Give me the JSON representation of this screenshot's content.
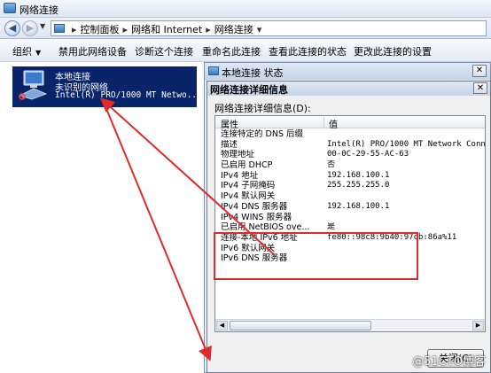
{
  "window": {
    "title": "网络连接"
  },
  "address": {
    "breadcrumbs": [
      "控制面板",
      "网络和 Internet",
      "网络连接"
    ]
  },
  "toolbar": {
    "organize": "组织",
    "disable": "禁用此网络设备",
    "diagnose": "诊断这个连接",
    "rename": "重命名此连接",
    "status": "查看此连接的状态",
    "settings": "更改此连接的设置"
  },
  "connection": {
    "name": "本地连接",
    "status": "未识别的网络",
    "device": "Intel(R) PRO/1000 MT Netwo..."
  },
  "status_window": {
    "title": "本地连接 状态"
  },
  "details": {
    "title": "网络连接详细信息",
    "label": "网络连接详细信息(D):",
    "columns": {
      "property": "属性",
      "value": "值"
    },
    "rows": [
      {
        "property": "连接特定的 DNS 后缀",
        "value": ""
      },
      {
        "property": "描述",
        "value": "Intel(R) PRO/1000 MT Network Conn"
      },
      {
        "property": "物理地址",
        "value": "00-0C-29-55-AC-63"
      },
      {
        "property": "已启用 DHCP",
        "value": "否"
      },
      {
        "property": "IPv4 地址",
        "value": "192.168.100.1"
      },
      {
        "property": "IPv4 子网掩码",
        "value": "255.255.255.0"
      },
      {
        "property": "IPv4 默认网关",
        "value": ""
      },
      {
        "property": "IPv4 DNS 服务器",
        "value": "192.168.100.1"
      },
      {
        "property": "IPv4 WINS 服务器",
        "value": ""
      },
      {
        "property": "已启用 NetBIOS ove...",
        "value": "是"
      },
      {
        "property": "连接-本地 IPv6 地址",
        "value": "fe80::98c8:9b40:97cb:86a%11"
      },
      {
        "property": "IPv6 默认网关",
        "value": ""
      },
      {
        "property": "IPv6 DNS 服务器",
        "value": ""
      }
    ],
    "close_button": "关闭(C)"
  },
  "watermark": "@51CTO博客",
  "colors": {
    "selection": "#0a246a",
    "annotation": "#e12a2a"
  }
}
